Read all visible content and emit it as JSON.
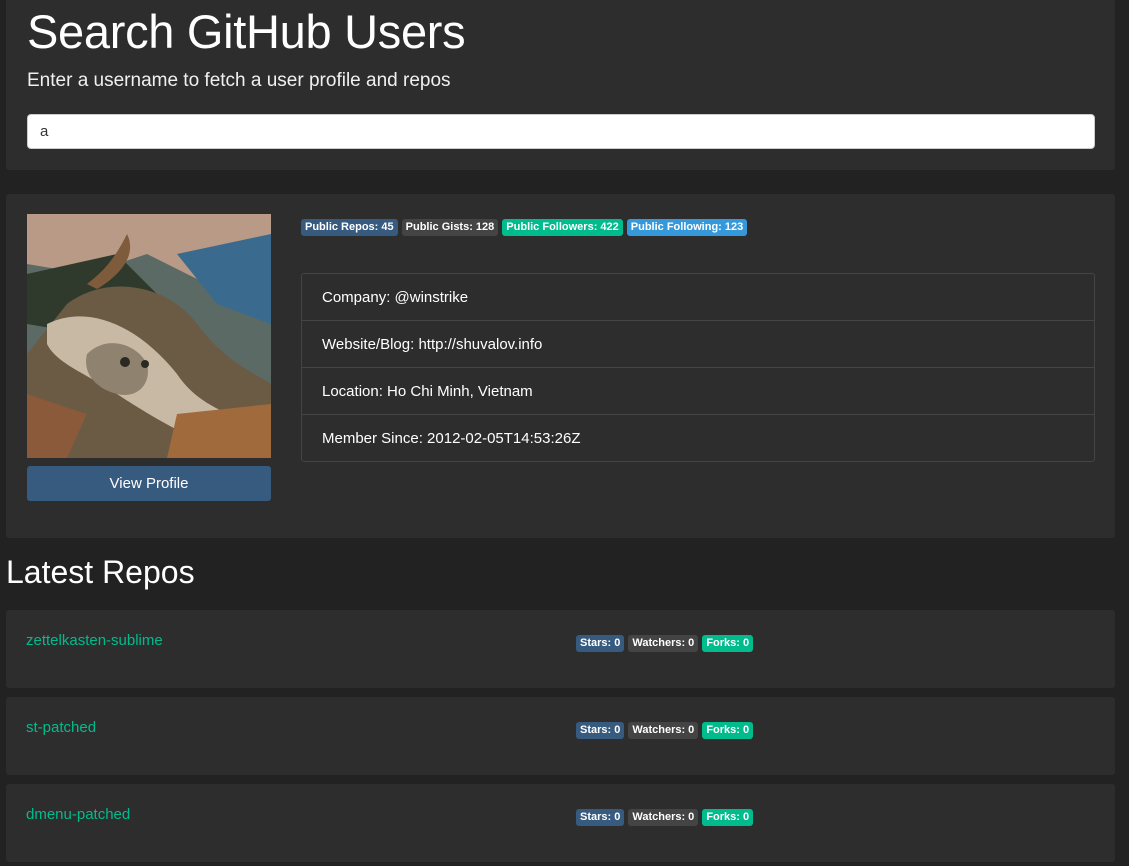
{
  "search": {
    "title": "Search GitHub Users",
    "subtitle": "Enter a username to fetch a user profile and repos",
    "input_value": "a"
  },
  "profile": {
    "view_profile_label": "View Profile",
    "badges": {
      "public_repos": "Public Repos: 45",
      "public_gists": "Public Gists: 128",
      "public_followers": "Public Followers: 422",
      "public_following": "Public Following: 123"
    },
    "info": {
      "company": "Company: @winstrike",
      "website": "Website/Blog: http://shuvalov.info",
      "location": "Location: Ho Chi Minh, Vietnam",
      "member_since": "Member Since: 2012-02-05T14:53:26Z"
    }
  },
  "repos": {
    "title": "Latest Repos",
    "items": [
      {
        "name": "zettelkasten-sublime",
        "stars": "Stars: 0",
        "watchers": "Watchers: 0",
        "forks": "Forks: 0"
      },
      {
        "name": "st-patched",
        "stars": "Stars: 0",
        "watchers": "Watchers: 0",
        "forks": "Forks: 0"
      },
      {
        "name": "dmenu-patched",
        "stars": "Stars: 0",
        "watchers": "Watchers: 0",
        "forks": "Forks: 0"
      }
    ]
  },
  "colors": {
    "background": "#222222",
    "card": "#2d2d2d",
    "primary": "#375a7f",
    "secondary": "#444444",
    "success": "#00bc8c",
    "info": "#3498db"
  }
}
